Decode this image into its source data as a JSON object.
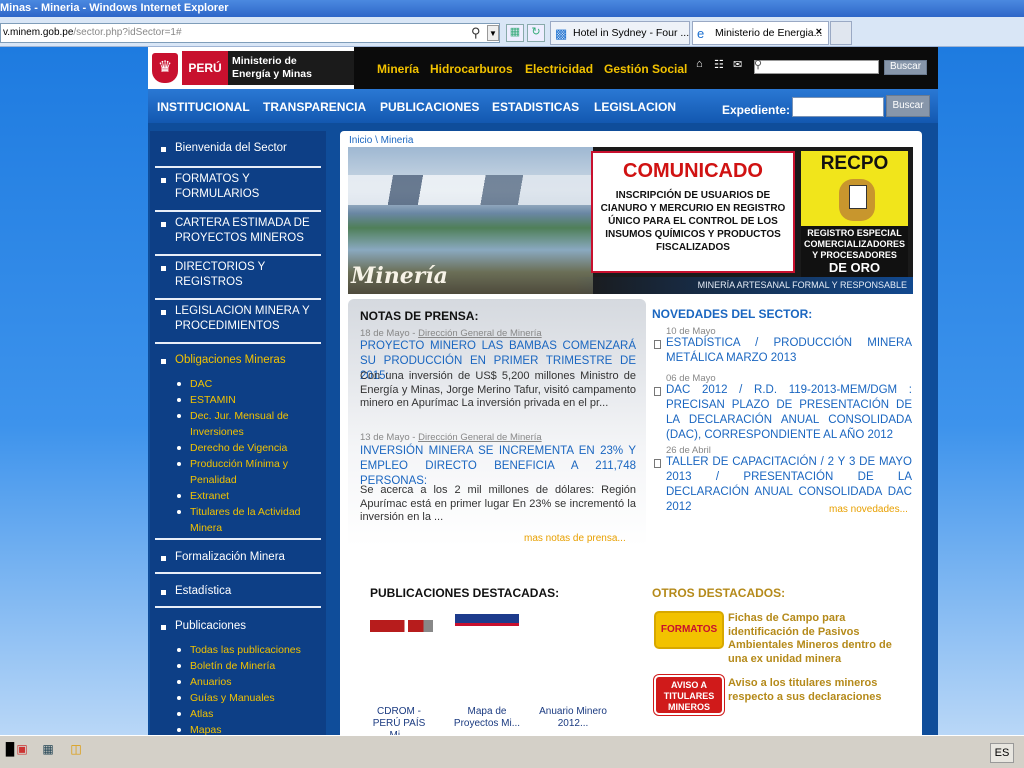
{
  "browser": {
    "title": "Minas - Mineria - Windows Internet Explorer",
    "url_host": "v.minem.gob.pe",
    "url_path": "/sector.php?idSector=1#",
    "tabs": [
      {
        "label": "Hotel in Sydney - Four ..."
      },
      {
        "label": "Ministerio de Energia..."
      }
    ],
    "tab_close": "×"
  },
  "header": {
    "peru": "PERÚ",
    "ministry_line1": "Ministerio de",
    "ministry_line2": "Energía y Minas",
    "links": [
      "Minería",
      "Hidrocarburos",
      "Electricidad",
      "Gestión Social"
    ],
    "search_button": "Buscar"
  },
  "nav": {
    "items": [
      "INSTITUCIONAL",
      "TRANSPARENCIA",
      "PUBLICACIONES",
      "ESTADISTICAS",
      "LEGISLACION"
    ],
    "expediente_label": "Expediente:",
    "search_button": "Buscar"
  },
  "sidebar": {
    "items": [
      {
        "label": "Bienvenida del Sector"
      },
      {
        "label": "FORMATOS Y FORMULARIOS"
      },
      {
        "label": "CARTERA ESTIMADA DE PROYECTOS MINEROS"
      },
      {
        "label": "DIRECTORIOS Y REGISTROS"
      },
      {
        "label": "LEGISLACION MINERA Y PROCEDIMIENTOS"
      },
      {
        "label": "Obligaciones Mineras"
      },
      {
        "label": "Formalización Minera"
      },
      {
        "label": "Estadística"
      },
      {
        "label": "Publicaciones"
      }
    ],
    "obligaciones_sub": [
      "DAC",
      "ESTAMIN",
      "Dec. Jur. Mensual de Inversiones",
      "Derecho de Vigencia",
      "Producción Mínima y Penalidad",
      "Extranet",
      "Titulares de la Actividad Minera"
    ],
    "publicaciones_sub": [
      "Todas las publicaciones",
      "Boletín de Minería",
      "Anuarios",
      "Guías y Manuales",
      "Atlas",
      "Mapas"
    ]
  },
  "main": {
    "breadcrumb": "Inicio \\ Mineria",
    "banner": {
      "title": "Minería",
      "comunicado_title": "COMUNICADO",
      "comunicado_text": "INSCRIPCIÓN DE USUARIOS DE CIANURO Y MERCURIO EN REGISTRO ÚNICO PARA EL CONTROL DE LOS INSUMOS QUÍMICOS Y PRODUCTOS FISCALIZADOS",
      "recpo_title": "RECPO",
      "recpo_line1": "REGISTRO ESPECIAL",
      "recpo_line2": "COMERCIALIZADORES Y PROCESADORES",
      "recpo_line3": "DE ORO",
      "footer": "MINERÍA ARTESANAL FORMAL Y RESPONSABLE"
    },
    "notas": {
      "title": "NOTAS DE PRENSA:",
      "items": [
        {
          "date": "18 de Mayo - ",
          "source": "Dirección General de Minería",
          "headline": "PROYECTO MINERO LAS BAMBAS COMENZARÁ SU PRODUCCIÓN EN PRIMER TRIMESTRE DE 2015:",
          "body": "Con una inversión de US$ 5,200 millones Ministro de Energía y Minas, Jorge Merino Tafur, visitó campamento minero en Apurímac  La inversión privada en el pr..."
        },
        {
          "date": "13 de Mayo - ",
          "source": "Dirección General de Minería",
          "headline": "INVERSIÓN MINERA SE INCREMENTA EN 23% Y EMPLEO DIRECTO BENEFICIA A 211,748 PERSONAS:",
          "body": "Se acerca a los 2 mil millones de dólares: Región Apurímac está en primer lugar  En 23% se incrementó la inversión en la ..."
        }
      ],
      "more": "mas notas de prensa..."
    },
    "novedades": {
      "title": "NOVEDADES DEL SECTOR:",
      "items": [
        {
          "date": "10 de Mayo",
          "text": "ESTADÍSTICA / PRODUCCIÓN MINERA METÁLICA MARZO 2013"
        },
        {
          "date": "06 de Mayo",
          "text": "DAC 2012 / R.D. 119-2013-MEM/DGM : PRECISAN PLAZO DE PRESENTACIÓN DE LA DECLARACIÓN ANUAL CONSOLIDADA (DAC), CORRESPONDIENTE AL AÑO 2012"
        },
        {
          "date": "26 de Abril",
          "text": "TALLER DE CAPACITACIÓN / 2 Y 3 DE MAYO 2013 / PRESENTACIÓN DE LA DECLARACIÓN ANUAL CONSOLIDADA DAC 2012"
        }
      ],
      "more": "mas novedades..."
    },
    "publicaciones": {
      "title": "PUBLICACIONES DESTACADAS:",
      "items": [
        {
          "label": "CDROM - PERÚ PAÍS Mi..."
        },
        {
          "label": "Mapa de Proyectos Mi..."
        },
        {
          "label": "Anuario Minero 2012..."
        }
      ]
    },
    "otros": {
      "title": "OTROS DESTACADOS:",
      "items": [
        {
          "badge": "FORMATOS",
          "text": "Fichas de Campo para identificación de Pasivos Ambientales Mineros dentro de una ex unidad minera"
        },
        {
          "badge_line1": "AVISO A",
          "badge_line2": "TITULARES",
          "badge_line3": "MINEROS",
          "text": "Aviso a los titulares mineros respecto a sus declaraciones"
        }
      ]
    }
  },
  "taskbar": {
    "lang": "ES"
  },
  "colors": {
    "brand_red": "#c8102e",
    "nav_blue": "#1358b0",
    "link_blue": "#1a66c0",
    "accent_yellow": "#f2c200"
  }
}
